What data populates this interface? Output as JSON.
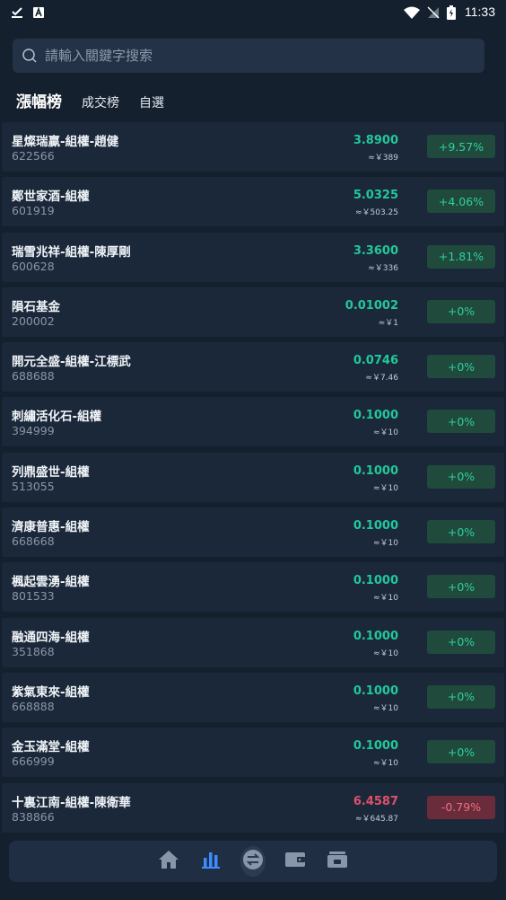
{
  "status_bar": {
    "time": "11:33"
  },
  "search": {
    "placeholder": "請輸入關鍵字搜索"
  },
  "tabs": [
    {
      "label": "漲幅榜",
      "active": true
    },
    {
      "label": "成交榜",
      "active": false
    },
    {
      "label": "自選",
      "active": false
    }
  ],
  "items": [
    {
      "name": "星燦瑞贏-組權-趙健",
      "code": "622566",
      "price": "3.8900",
      "approx": "≈￥389",
      "change": "+9.57%",
      "trend": "up"
    },
    {
      "name": "鄭世家酒-組權",
      "code": "601919",
      "price": "5.0325",
      "approx": "≈￥503.25",
      "change": "+4.06%",
      "trend": "up"
    },
    {
      "name": "瑞雪兆祥-組權-陳厚剛",
      "code": "600628",
      "price": "3.3600",
      "approx": "≈￥336",
      "change": "+1.81%",
      "trend": "up"
    },
    {
      "name": "隕石基金",
      "code": "200002",
      "price": "0.01002",
      "approx": "≈￥1",
      "change": "+0%",
      "trend": "up"
    },
    {
      "name": "開元全盛-組權-江標武",
      "code": "688688",
      "price": "0.0746",
      "approx": "≈￥7.46",
      "change": "+0%",
      "trend": "up"
    },
    {
      "name": "刺繡活化石-組權",
      "code": "394999",
      "price": "0.1000",
      "approx": "≈￥10",
      "change": "+0%",
      "trend": "up"
    },
    {
      "name": "列鼎盛世-組權",
      "code": "513055",
      "price": "0.1000",
      "approx": "≈￥10",
      "change": "+0%",
      "trend": "up"
    },
    {
      "name": "濟康普惠-組權",
      "code": "668668",
      "price": "0.1000",
      "approx": "≈￥10",
      "change": "+0%",
      "trend": "up"
    },
    {
      "name": "楓起雲湧-組權",
      "code": "801533",
      "price": "0.1000",
      "approx": "≈￥10",
      "change": "+0%",
      "trend": "up"
    },
    {
      "name": "融通四海-組權",
      "code": "351868",
      "price": "0.1000",
      "approx": "≈￥10",
      "change": "+0%",
      "trend": "up"
    },
    {
      "name": "紫氣東來-組權",
      "code": "668888",
      "price": "0.1000",
      "approx": "≈￥10",
      "change": "+0%",
      "trend": "up"
    },
    {
      "name": "金玉滿堂-組權",
      "code": "666999",
      "price": "0.1000",
      "approx": "≈￥10",
      "change": "+0%",
      "trend": "up"
    },
    {
      "name": "十裏江南-組權-陳衛華",
      "code": "838866",
      "price": "6.4587",
      "approx": "≈￥645.87",
      "change": "-0.79%",
      "trend": "down"
    }
  ],
  "nav": [
    {
      "icon": "home-icon",
      "active": false
    },
    {
      "icon": "market-chart-icon",
      "active": true
    },
    {
      "icon": "exchange-icon",
      "active": false
    },
    {
      "icon": "wallet-icon",
      "active": false
    },
    {
      "icon": "assets-icon",
      "active": false
    }
  ],
  "colors": {
    "background": "#14202e",
    "row": "#1b283a",
    "up": "#22c89a",
    "down": "#e0506a",
    "accent": "#3b8cff"
  }
}
